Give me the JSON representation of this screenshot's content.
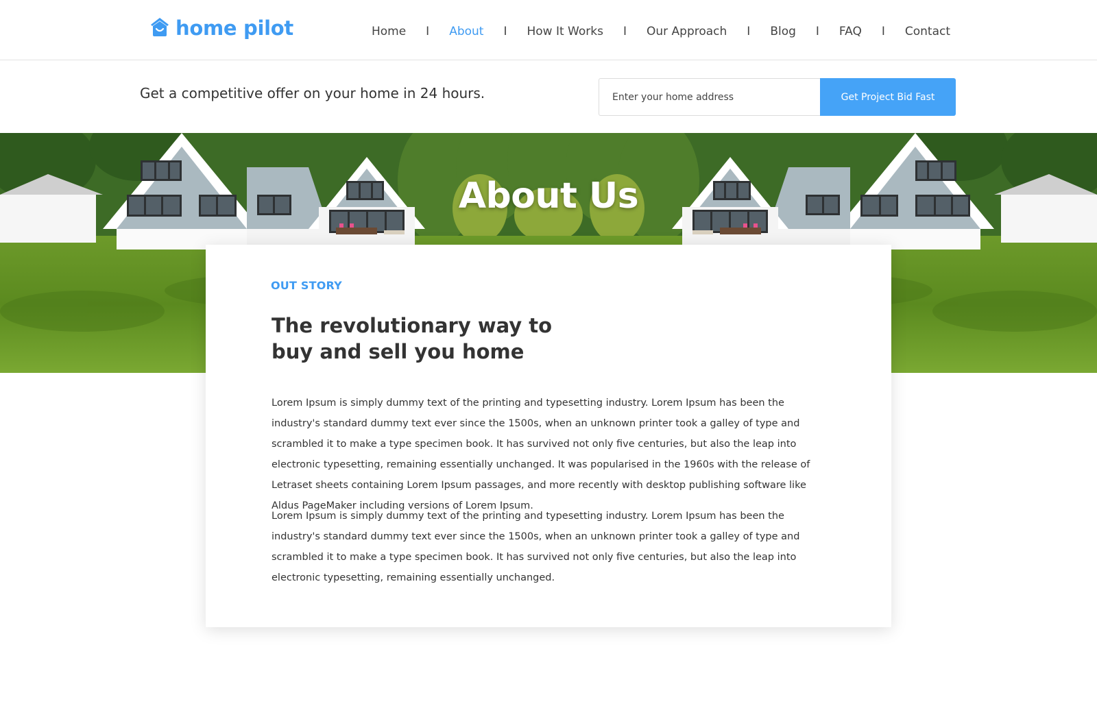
{
  "brand": {
    "name": "home pilot",
    "accent": "#3f9bf2",
    "icon": "house-icon"
  },
  "nav": {
    "items": [
      {
        "label": "Home",
        "active": false
      },
      {
        "label": "About",
        "active": true
      },
      {
        "label": "How It Works",
        "active": false
      },
      {
        "label": "Our Approach",
        "active": false
      },
      {
        "label": "Blog",
        "active": false
      },
      {
        "label": "FAQ",
        "active": false
      },
      {
        "label": "Contact",
        "active": false
      }
    ],
    "separator": "I"
  },
  "offer": {
    "text": "Get a competitive offer on your home in 24 hours.",
    "input_placeholder": "Enter your home address",
    "input_value": "",
    "button_label": "Get Project Bid Fast",
    "button_color": "#45a3f7"
  },
  "hero": {
    "title": "About Us"
  },
  "story": {
    "eyebrow": "OUT STORY",
    "heading": "The revolutionary way to buy and sell you home",
    "paragraphs": [
      "Lorem Ipsum is simply dummy text of the printing and typesetting industry. Lorem Ipsum has been the industry's standard dummy text ever since the 1500s, when an unknown printer took a galley of type and scrambled it to make a type specimen book. It has survived not only five centuries, but also the leap into electronic typesetting, remaining essentially unchanged. It was popularised in the 1960s with the release of Letraset sheets containing Lorem Ipsum passages, and more recently with desktop publishing software like Aldus PageMaker including versions of Lorem Ipsum.",
      "Lorem Ipsum is simply dummy text of the printing and typesetting industry. Lorem Ipsum has been the industry's standard dummy text ever since the 1500s, when an unknown printer took a galley of type and scrambled it to make a type specimen book. It has survived not only five centuries, but also the leap into electronic typesetting, remaining essentially unchanged."
    ]
  }
}
